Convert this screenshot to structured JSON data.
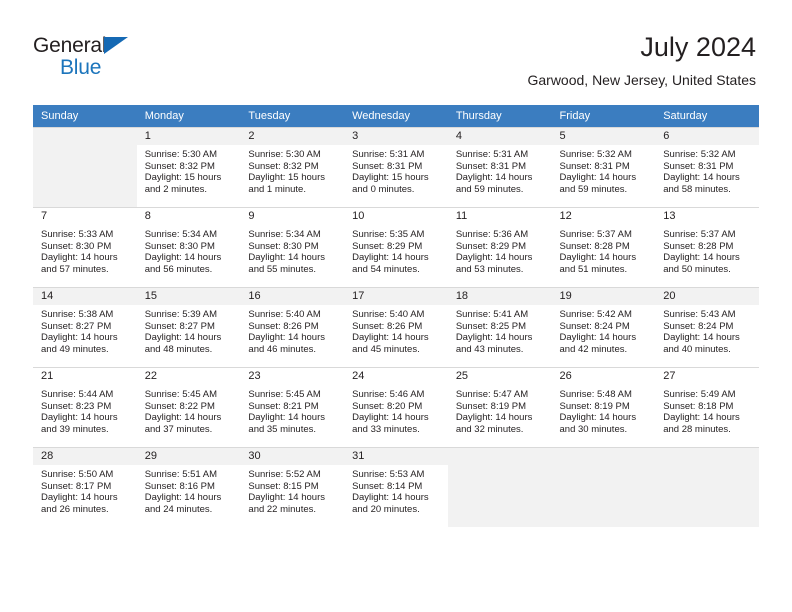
{
  "brand": {
    "name_top": "General",
    "name_bottom": "Blue",
    "accent_color": "#1c75bc",
    "triangle_color": "#1569b4"
  },
  "header": {
    "title": "July 2024",
    "subtitle": "Garwood, New Jersey, United States"
  },
  "theme": {
    "header_row_bg": "#3b7dc0",
    "header_row_text": "#ffffff",
    "daynum_band_bg": "#f2f2f2",
    "grid_line": "#d9d9d9",
    "body_text": "#231f20"
  },
  "weekdays": [
    "Sunday",
    "Monday",
    "Tuesday",
    "Wednesday",
    "Thursday",
    "Friday",
    "Saturday"
  ],
  "calendar": {
    "weeks": [
      [
        {
          "day": "",
          "sunrise": "",
          "sunset": "",
          "daylight1": "",
          "daylight2": ""
        },
        {
          "day": "1",
          "sunrise": "Sunrise: 5:30 AM",
          "sunset": "Sunset: 8:32 PM",
          "daylight1": "Daylight: 15 hours",
          "daylight2": "and 2 minutes."
        },
        {
          "day": "2",
          "sunrise": "Sunrise: 5:30 AM",
          "sunset": "Sunset: 8:32 PM",
          "daylight1": "Daylight: 15 hours",
          "daylight2": "and 1 minute."
        },
        {
          "day": "3",
          "sunrise": "Sunrise: 5:31 AM",
          "sunset": "Sunset: 8:31 PM",
          "daylight1": "Daylight: 15 hours",
          "daylight2": "and 0 minutes."
        },
        {
          "day": "4",
          "sunrise": "Sunrise: 5:31 AM",
          "sunset": "Sunset: 8:31 PM",
          "daylight1": "Daylight: 14 hours",
          "daylight2": "and 59 minutes."
        },
        {
          "day": "5",
          "sunrise": "Sunrise: 5:32 AM",
          "sunset": "Sunset: 8:31 PM",
          "daylight1": "Daylight: 14 hours",
          "daylight2": "and 59 minutes."
        },
        {
          "day": "6",
          "sunrise": "Sunrise: 5:32 AM",
          "sunset": "Sunset: 8:31 PM",
          "daylight1": "Daylight: 14 hours",
          "daylight2": "and 58 minutes."
        }
      ],
      [
        {
          "day": "7",
          "sunrise": "Sunrise: 5:33 AM",
          "sunset": "Sunset: 8:30 PM",
          "daylight1": "Daylight: 14 hours",
          "daylight2": "and 57 minutes."
        },
        {
          "day": "8",
          "sunrise": "Sunrise: 5:34 AM",
          "sunset": "Sunset: 8:30 PM",
          "daylight1": "Daylight: 14 hours",
          "daylight2": "and 56 minutes."
        },
        {
          "day": "9",
          "sunrise": "Sunrise: 5:34 AM",
          "sunset": "Sunset: 8:30 PM",
          "daylight1": "Daylight: 14 hours",
          "daylight2": "and 55 minutes."
        },
        {
          "day": "10",
          "sunrise": "Sunrise: 5:35 AM",
          "sunset": "Sunset: 8:29 PM",
          "daylight1": "Daylight: 14 hours",
          "daylight2": "and 54 minutes."
        },
        {
          "day": "11",
          "sunrise": "Sunrise: 5:36 AM",
          "sunset": "Sunset: 8:29 PM",
          "daylight1": "Daylight: 14 hours",
          "daylight2": "and 53 minutes."
        },
        {
          "day": "12",
          "sunrise": "Sunrise: 5:37 AM",
          "sunset": "Sunset: 8:28 PM",
          "daylight1": "Daylight: 14 hours",
          "daylight2": "and 51 minutes."
        },
        {
          "day": "13",
          "sunrise": "Sunrise: 5:37 AM",
          "sunset": "Sunset: 8:28 PM",
          "daylight1": "Daylight: 14 hours",
          "daylight2": "and 50 minutes."
        }
      ],
      [
        {
          "day": "14",
          "sunrise": "Sunrise: 5:38 AM",
          "sunset": "Sunset: 8:27 PM",
          "daylight1": "Daylight: 14 hours",
          "daylight2": "and 49 minutes."
        },
        {
          "day": "15",
          "sunrise": "Sunrise: 5:39 AM",
          "sunset": "Sunset: 8:27 PM",
          "daylight1": "Daylight: 14 hours",
          "daylight2": "and 48 minutes."
        },
        {
          "day": "16",
          "sunrise": "Sunrise: 5:40 AM",
          "sunset": "Sunset: 8:26 PM",
          "daylight1": "Daylight: 14 hours",
          "daylight2": "and 46 minutes."
        },
        {
          "day": "17",
          "sunrise": "Sunrise: 5:40 AM",
          "sunset": "Sunset: 8:26 PM",
          "daylight1": "Daylight: 14 hours",
          "daylight2": "and 45 minutes."
        },
        {
          "day": "18",
          "sunrise": "Sunrise: 5:41 AM",
          "sunset": "Sunset: 8:25 PM",
          "daylight1": "Daylight: 14 hours",
          "daylight2": "and 43 minutes."
        },
        {
          "day": "19",
          "sunrise": "Sunrise: 5:42 AM",
          "sunset": "Sunset: 8:24 PM",
          "daylight1": "Daylight: 14 hours",
          "daylight2": "and 42 minutes."
        },
        {
          "day": "20",
          "sunrise": "Sunrise: 5:43 AM",
          "sunset": "Sunset: 8:24 PM",
          "daylight1": "Daylight: 14 hours",
          "daylight2": "and 40 minutes."
        }
      ],
      [
        {
          "day": "21",
          "sunrise": "Sunrise: 5:44 AM",
          "sunset": "Sunset: 8:23 PM",
          "daylight1": "Daylight: 14 hours",
          "daylight2": "and 39 minutes."
        },
        {
          "day": "22",
          "sunrise": "Sunrise: 5:45 AM",
          "sunset": "Sunset: 8:22 PM",
          "daylight1": "Daylight: 14 hours",
          "daylight2": "and 37 minutes."
        },
        {
          "day": "23",
          "sunrise": "Sunrise: 5:45 AM",
          "sunset": "Sunset: 8:21 PM",
          "daylight1": "Daylight: 14 hours",
          "daylight2": "and 35 minutes."
        },
        {
          "day": "24",
          "sunrise": "Sunrise: 5:46 AM",
          "sunset": "Sunset: 8:20 PM",
          "daylight1": "Daylight: 14 hours",
          "daylight2": "and 33 minutes."
        },
        {
          "day": "25",
          "sunrise": "Sunrise: 5:47 AM",
          "sunset": "Sunset: 8:19 PM",
          "daylight1": "Daylight: 14 hours",
          "daylight2": "and 32 minutes."
        },
        {
          "day": "26",
          "sunrise": "Sunrise: 5:48 AM",
          "sunset": "Sunset: 8:19 PM",
          "daylight1": "Daylight: 14 hours",
          "daylight2": "and 30 minutes."
        },
        {
          "day": "27",
          "sunrise": "Sunrise: 5:49 AM",
          "sunset": "Sunset: 8:18 PM",
          "daylight1": "Daylight: 14 hours",
          "daylight2": "and 28 minutes."
        }
      ],
      [
        {
          "day": "28",
          "sunrise": "Sunrise: 5:50 AM",
          "sunset": "Sunset: 8:17 PM",
          "daylight1": "Daylight: 14 hours",
          "daylight2": "and 26 minutes."
        },
        {
          "day": "29",
          "sunrise": "Sunrise: 5:51 AM",
          "sunset": "Sunset: 8:16 PM",
          "daylight1": "Daylight: 14 hours",
          "daylight2": "and 24 minutes."
        },
        {
          "day": "30",
          "sunrise": "Sunrise: 5:52 AM",
          "sunset": "Sunset: 8:15 PM",
          "daylight1": "Daylight: 14 hours",
          "daylight2": "and 22 minutes."
        },
        {
          "day": "31",
          "sunrise": "Sunrise: 5:53 AM",
          "sunset": "Sunset: 8:14 PM",
          "daylight1": "Daylight: 14 hours",
          "daylight2": "and 20 minutes."
        },
        {
          "day": "",
          "sunrise": "",
          "sunset": "",
          "daylight1": "",
          "daylight2": ""
        },
        {
          "day": "",
          "sunrise": "",
          "sunset": "",
          "daylight1": "",
          "daylight2": ""
        },
        {
          "day": "",
          "sunrise": "",
          "sunset": "",
          "daylight1": "",
          "daylight2": ""
        }
      ]
    ]
  }
}
